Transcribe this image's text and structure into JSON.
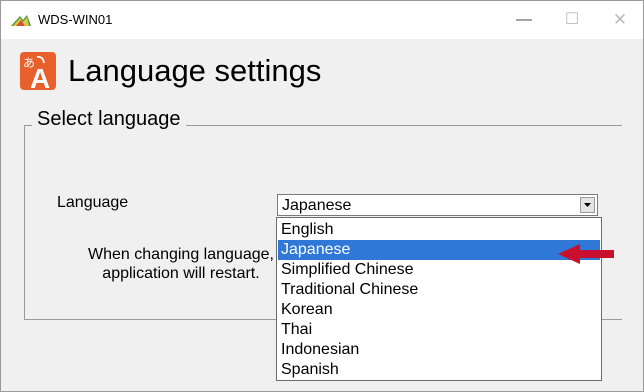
{
  "window": {
    "title": "WDS-WIN01",
    "minimize_label": "—",
    "maximize_label": "☐",
    "close_label": "✕"
  },
  "header": {
    "title": "Language settings",
    "icon": "language-translate-icon"
  },
  "group": {
    "title": "Select language",
    "language_label": "Language",
    "selected_value": "Japanese",
    "note_line1": "When changing language,",
    "note_line2": "application will restart."
  },
  "dropdown": {
    "options": [
      "English",
      "Japanese",
      "Simplified Chinese",
      "Traditional Chinese",
      "Korean",
      "Thai",
      "Indonesian",
      "Spanish"
    ],
    "highlighted_index": 1
  },
  "colors": {
    "highlight": "#2f78d7",
    "arrow": "#c8102e",
    "icon_orange": "#e8602c"
  }
}
